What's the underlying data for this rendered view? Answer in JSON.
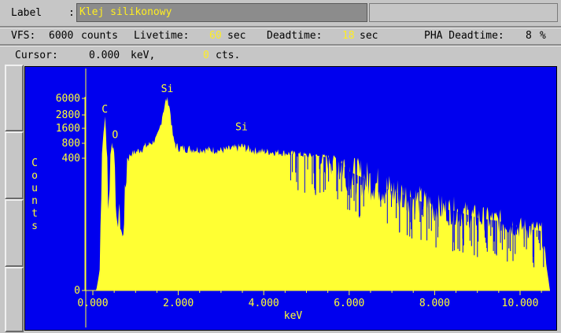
{
  "header": {
    "label_caption": "Label",
    "label_colon": ":",
    "label_value": "Klej silikonowy"
  },
  "status": {
    "vfs_caption": "VFS:",
    "vfs_value": "6000",
    "vfs_unit": "counts",
    "livetime_caption": "Livetime:",
    "livetime_value": "60",
    "livetime_unit": "sec",
    "deadtime_caption": "Deadtime:",
    "deadtime_value": "18",
    "deadtime_unit": "sec",
    "pha_caption": "PHA Deadtime:",
    "pha_value": "8",
    "pha_unit": "%"
  },
  "cursor": {
    "caption": "Cursor:",
    "energy": "0.000",
    "energy_unit": "keV,",
    "counts": "0",
    "counts_unit": "cts."
  },
  "colors": {
    "plot_background": "#0000ee",
    "spectrum_fill": "#ffff33",
    "highlight_text": "#ffee22",
    "panel": "#c6c6c6"
  },
  "chart_data": {
    "type": "area",
    "xlabel": "keV",
    "ylabel": "Counts",
    "xlim": [
      0,
      10.7
    ],
    "xticks": [
      0,
      2,
      4,
      6,
      8,
      10
    ],
    "xtick_labels": [
      "0.000",
      "2.000",
      "4.000",
      "6.000",
      "8.000",
      "10.000"
    ],
    "yscale": "piecewise",
    "ytick_labels": [
      "6000",
      "2800",
      "1600",
      "800",
      "400",
      "0"
    ],
    "peak_labels": [
      {
        "text": "C",
        "x": 0.28,
        "y": 2600
      },
      {
        "text": "O",
        "x": 0.52,
        "y": 820
      },
      {
        "text": "Si",
        "x": 1.74,
        "y": 6100
      },
      {
        "text": "Si",
        "x": 3.48,
        "y": 1250
      }
    ],
    "series": [
      {
        "x": [
          0.0,
          0.08,
          0.16,
          0.2,
          0.24,
          0.28,
          0.32,
          0.36,
          0.4,
          0.44,
          0.48,
          0.52,
          0.56,
          0.6,
          0.7,
          0.8,
          0.9,
          1.0,
          1.1,
          1.2,
          1.3,
          1.4,
          1.5,
          1.55,
          1.6,
          1.65,
          1.7,
          1.74,
          1.78,
          1.82,
          1.86,
          1.9,
          1.95,
          2.0,
          2.2,
          2.4,
          2.6,
          2.8,
          3.0,
          3.2,
          3.4,
          3.5,
          3.6,
          3.8,
          4.0,
          4.5,
          5.0,
          5.5,
          6.0,
          6.5,
          7.0,
          7.5,
          8.0,
          8.5,
          9.0,
          9.5,
          10.0,
          10.5,
          10.7
        ],
        "y": [
          0,
          0,
          60,
          350,
          1000,
          2600,
          700,
          180,
          400,
          800,
          700,
          400,
          150,
          250,
          150,
          400,
          520,
          560,
          620,
          700,
          760,
          860,
          1100,
          1400,
          2100,
          3600,
          5200,
          6100,
          5100,
          2800,
          1400,
          900,
          720,
          680,
          650,
          640,
          630,
          620,
          610,
          640,
          680,
          720,
          660,
          600,
          580,
          540,
          480,
          430,
          360,
          330,
          300,
          280,
          250,
          240,
          220,
          210,
          190,
          180,
          0
        ]
      }
    ]
  }
}
